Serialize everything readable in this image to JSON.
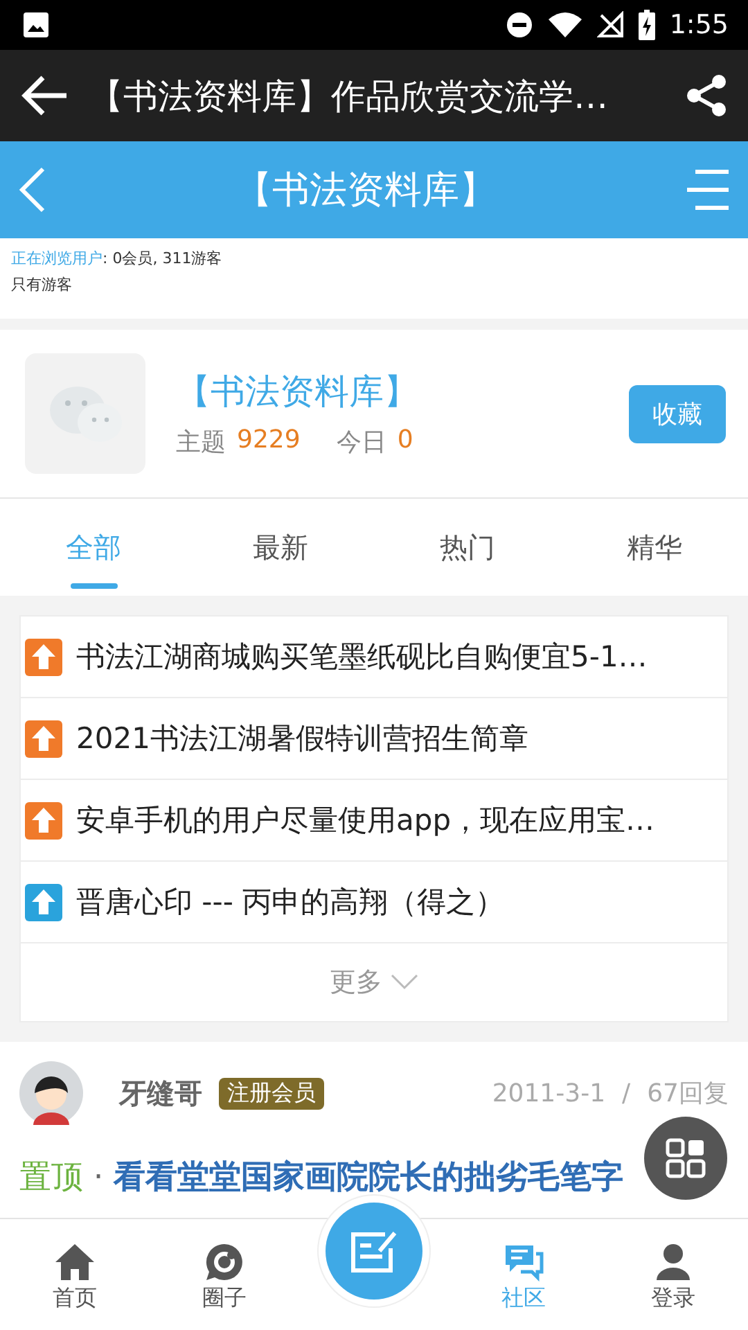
{
  "status_bar": {
    "time": "1:55"
  },
  "app_bar": {
    "title": "【书法资料库】作品欣赏交流学…"
  },
  "forum_bar": {
    "title": "【书法资料库】"
  },
  "online": {
    "label": "正在浏览用户",
    "count": ": 0会员, 311游客",
    "note": "只有游客"
  },
  "forum": {
    "name": "【书法资料库】",
    "topics_label": "主题",
    "topics": "9229",
    "today_label": "今日",
    "today": "0",
    "button": "收藏"
  },
  "tabs": [
    {
      "label": "全部",
      "selected": true
    },
    {
      "label": "最新",
      "selected": false
    },
    {
      "label": "热门",
      "selected": false
    },
    {
      "label": "精华",
      "selected": false
    }
  ],
  "pinned": [
    {
      "title": "书法江湖商城购买笔墨纸砚比自购便宜5-1…",
      "color": "#f07a2a"
    },
    {
      "title": "2021书法江湖暑假特训营招生简章",
      "color": "#f07a2a"
    },
    {
      "title": "安卓手机的用户尽量使用app，现在应用宝…",
      "color": "#f07a2a"
    },
    {
      "title": "晋唐心印 --- 丙申的高翔（得之）",
      "color": "#2aa3dc"
    }
  ],
  "more": "更多",
  "post": {
    "author": "牙缝哥",
    "badge": "注册会员",
    "date": "2011-3-1",
    "separator": "/",
    "replies": "67回复",
    "tag": "置顶",
    "dot": "·",
    "title": "看看堂堂国家画院院长的拙劣毛笔字"
  },
  "nav": [
    {
      "label": "首页",
      "kind": "home",
      "selected": false
    },
    {
      "label": "圈子",
      "kind": "circle",
      "selected": false
    },
    {
      "kind": "post"
    },
    {
      "label": "社区",
      "kind": "community",
      "selected": true
    },
    {
      "label": "登录",
      "kind": "login",
      "selected": false
    }
  ]
}
